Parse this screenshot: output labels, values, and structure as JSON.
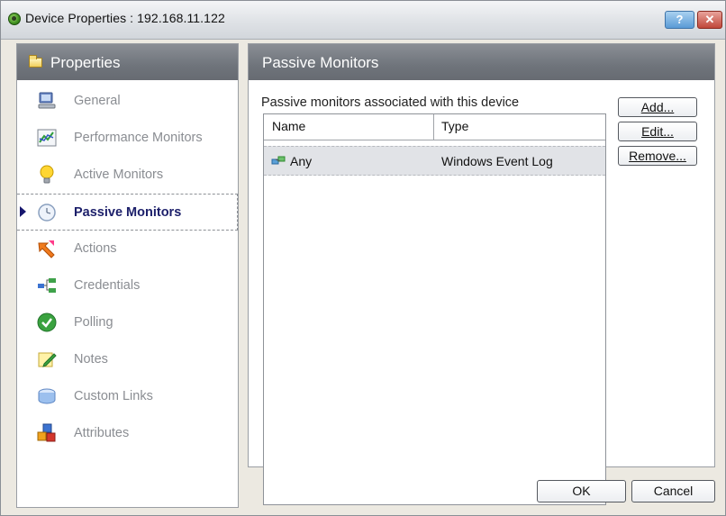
{
  "window": {
    "title": "Device Properties : 192.168.11.122",
    "help_label": "?",
    "close_label": "✕"
  },
  "sidebar": {
    "title": "Properties",
    "items": [
      {
        "label": "General",
        "icon": "computer-icon"
      },
      {
        "label": "Performance Monitors",
        "icon": "chart-icon"
      },
      {
        "label": "Active Monitors",
        "icon": "lightbulb-icon"
      },
      {
        "label": "Passive Monitors",
        "icon": "clock-icon",
        "active": true
      },
      {
        "label": "Actions",
        "icon": "arrow-icon"
      },
      {
        "label": "Credentials",
        "icon": "network-icon"
      },
      {
        "label": "Polling",
        "icon": "check-icon"
      },
      {
        "label": "Notes",
        "icon": "pencil-note-icon"
      },
      {
        "label": "Custom Links",
        "icon": "links-icon"
      },
      {
        "label": "Attributes",
        "icon": "blocks-icon"
      }
    ]
  },
  "main": {
    "title": "Passive Monitors",
    "caption": "Passive monitors associated with this device",
    "table": {
      "columns": [
        "Name",
        "Type"
      ],
      "rows": [
        {
          "name": "Any",
          "type": "Windows Event Log",
          "icon": "event-log-icon"
        }
      ]
    },
    "buttons": {
      "add": "Add...",
      "edit": "Edit...",
      "remove": "Remove..."
    }
  },
  "footer": {
    "ok": "OK",
    "cancel": "Cancel"
  }
}
